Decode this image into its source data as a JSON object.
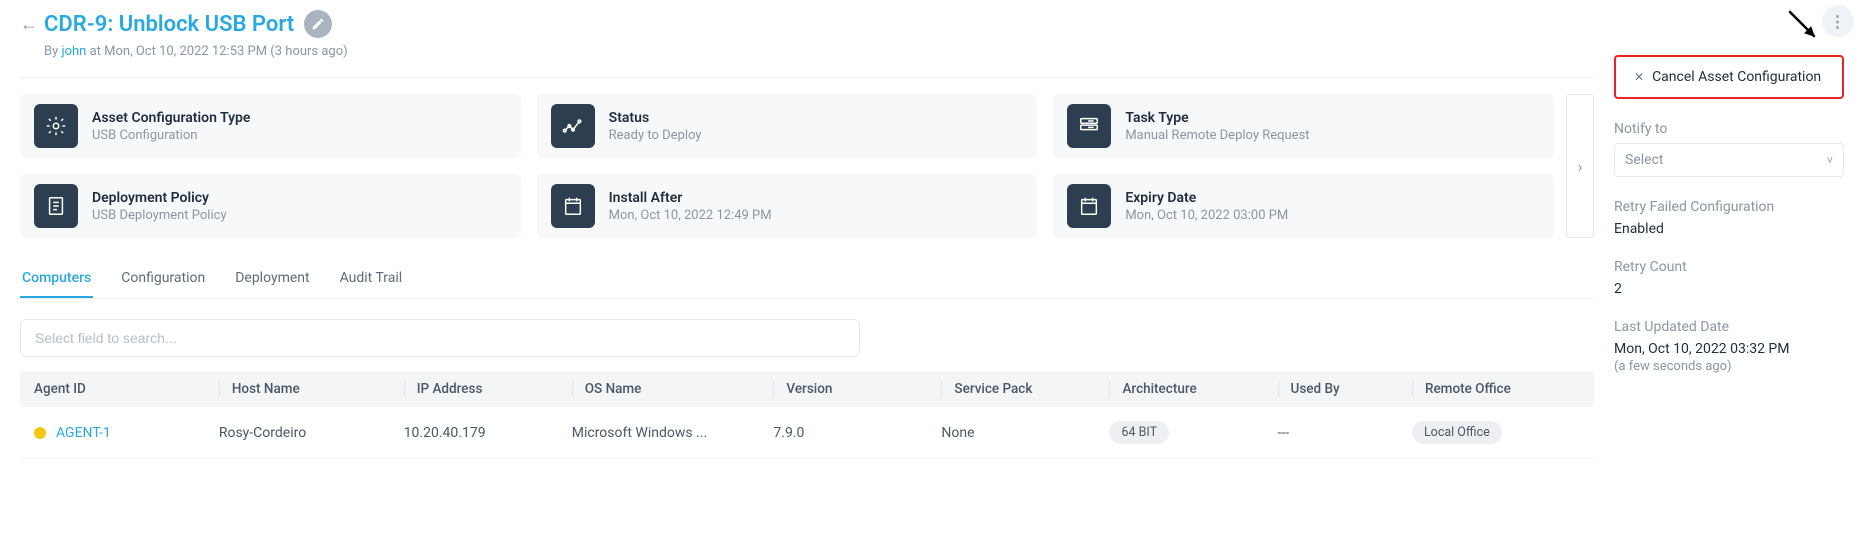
{
  "header": {
    "title": "CDR-9: Unblock USB Port",
    "by_prefix": "By ",
    "author": "john",
    "timestamp": " at Mon, Oct 10, 2022 12:53 PM (3 hours ago)"
  },
  "cards": [
    {
      "label": "Asset Configuration Type",
      "value": "USB Configuration",
      "icon": "gear"
    },
    {
      "label": "Status",
      "value": "Ready to Deploy",
      "icon": "graph"
    },
    {
      "label": "Task Type",
      "value": "Manual Remote Deploy Request",
      "icon": "server"
    },
    {
      "label": "Deployment Policy",
      "value": "USB Deployment Policy",
      "icon": "doc"
    },
    {
      "label": "Install After",
      "value": "Mon, Oct 10, 2022 12:49 PM",
      "icon": "cal"
    },
    {
      "label": "Expiry Date",
      "value": "Mon, Oct 10, 2022 03:00 PM",
      "icon": "cal"
    }
  ],
  "tabs": [
    "Computers",
    "Configuration",
    "Deployment",
    "Audit Trail"
  ],
  "active_tab": 0,
  "search_placeholder": "Select field to search...",
  "table": {
    "headers": [
      "Agent ID",
      "Host Name",
      "IP Address",
      "OS Name",
      "Version",
      "Service Pack",
      "Architecture",
      "Used By",
      "Remote Office"
    ],
    "rows": [
      {
        "status_color": "#f5c518",
        "agent_id": "AGENT-1",
        "host": "Rosy-Cordeiro",
        "ip": "10.20.40.179",
        "os": "Microsoft Windows ...",
        "ver": "7.9.0",
        "sp": "None",
        "arch": "64 BIT",
        "used_by": "---",
        "office": "Local Office"
      }
    ]
  },
  "side": {
    "cancel_label": "Cancel Asset Configuration",
    "notify_label": "Notify to",
    "notify_placeholder": "Select",
    "retry_label": "Retry Failed Configuration",
    "retry_value": "Enabled",
    "retry_count_label": "Retry Count",
    "retry_count_value": "2",
    "updated_label": "Last Updated Date",
    "updated_value": "Mon, Oct 10, 2022 03:32 PM",
    "updated_sub": "(a few seconds ago)"
  },
  "icons": {
    "more": "⋮",
    "chevron_right": "›",
    "chevron_down": "˅",
    "close": "✕"
  }
}
